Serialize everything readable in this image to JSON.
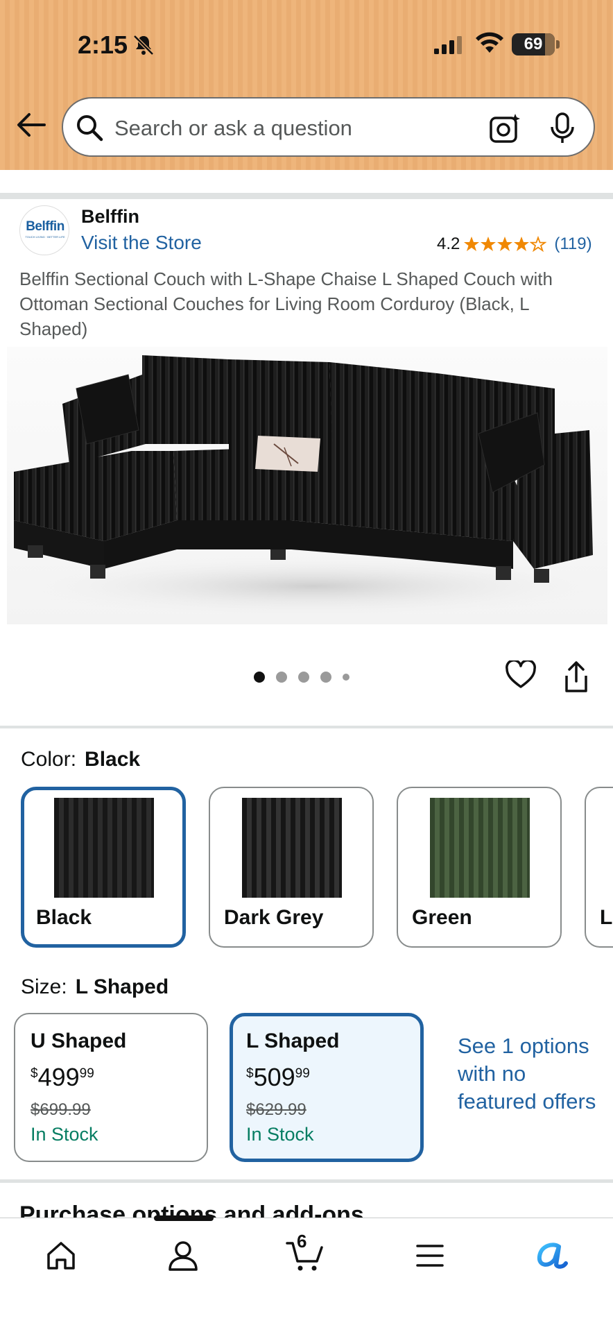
{
  "status_bar": {
    "time": "2:15",
    "battery": "69"
  },
  "search": {
    "placeholder": "Search or ask a question"
  },
  "brand": {
    "logo_text": "Belffin",
    "logo_tagline": "TOUCH LIVING · BETTER LIFE",
    "name": "Belffin",
    "store_link": "Visit the Store",
    "rating": "4.2",
    "rating_count": "(119)",
    "stars": 4.2
  },
  "product": {
    "title": "Belffin Sectional Couch with L-Shape Chaise L Shaped Couch with Ottoman Sectional Couches for Living Room Corduroy (Black, L Shaped)",
    "image_alt": "black corduroy L-shaped sectional couch"
  },
  "carousel": {
    "total_dots": 5,
    "active_index": 0
  },
  "color_section": {
    "label": "Color:",
    "selected": "Black",
    "options": [
      {
        "name": "Black",
        "c1": "#171717",
        "c2": "#2a2a2a",
        "selected": true
      },
      {
        "name": "Dark Grey",
        "c1": "#161616",
        "c2": "#303030",
        "selected": false
      },
      {
        "name": "Green",
        "c1": "#33462c",
        "c2": "#4a6040",
        "selected": false
      },
      {
        "name": "L",
        "c1": "#cccccc",
        "c2": "#bbbbbb",
        "selected": false
      }
    ]
  },
  "size_section": {
    "label": "Size:",
    "selected": "L Shaped",
    "options": [
      {
        "name": "U Shaped",
        "currency": "$",
        "price_whole": "499",
        "price_fraction": "99",
        "list_price": "$699.99",
        "stock": "In Stock",
        "selected": false
      },
      {
        "name": "L Shaped",
        "currency": "$",
        "price_whole": "509",
        "price_fraction": "99",
        "list_price": "$629.99",
        "stock": "In Stock",
        "selected": true
      }
    ],
    "see_more": "See 1 options with no featured offers"
  },
  "next_section": {
    "heading": "Purchase options and add-ons"
  },
  "bottom_nav": {
    "cart_count": "6",
    "items": [
      "home-icon",
      "account-icon",
      "cart-icon",
      "menu-icon",
      "rufus-icon"
    ]
  },
  "colors": {
    "accent_link": "#2162a1",
    "in_stock": "#067d62",
    "star": "#f08804",
    "header_bg": "#eeb57b"
  }
}
